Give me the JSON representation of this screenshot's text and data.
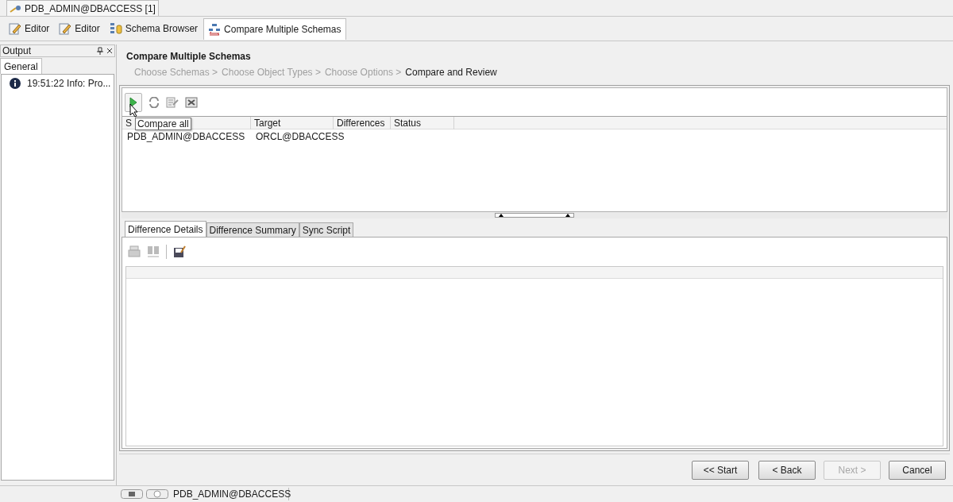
{
  "document_tab": {
    "label": "PDB_ADMIN@DBACCESS [1]"
  },
  "editor_tabs": [
    {
      "label": "Editor",
      "kind": "editor",
      "selected": false
    },
    {
      "label": "Editor",
      "kind": "editor",
      "selected": false
    },
    {
      "label": "Schema Browser",
      "kind": "browser",
      "selected": false
    },
    {
      "label": "Compare Multiple Schemas",
      "kind": "compare",
      "selected": true
    }
  ],
  "output_panel": {
    "title": "Output",
    "tabs": [
      {
        "label": "General",
        "selected": true
      }
    ],
    "messages": [
      "19:51:22 Info: Pro..."
    ]
  },
  "wizard": {
    "title": "Compare Multiple Schemas",
    "steps": [
      {
        "label": "Choose Schemas >",
        "selected": false
      },
      {
        "label": "Choose Object Types >",
        "selected": false
      },
      {
        "label": "Choose Options >",
        "selected": false
      },
      {
        "label": "Compare and Review",
        "selected": true
      }
    ],
    "tooltip": "Compare all",
    "table": {
      "columns": [
        "S",
        "Target",
        "Differences",
        "Status"
      ],
      "rows": [
        [
          "PDB_ADMIN@DBACCESS",
          "ORCL@DBACCESS",
          "",
          ""
        ]
      ]
    },
    "detail_tabs": [
      {
        "label": "Difference Details",
        "selected": true
      },
      {
        "label": "Difference Summary",
        "selected": false
      },
      {
        "label": "Sync Script",
        "selected": false
      }
    ],
    "buttons": [
      {
        "label": "<< Start",
        "disabled": false
      },
      {
        "label": "< Back",
        "disabled": false
      },
      {
        "label": "Next >",
        "disabled": true
      },
      {
        "label": "Cancel",
        "disabled": false
      }
    ]
  },
  "status_bar": {
    "connection": "PDB_ADMIN@DBACCESS"
  }
}
